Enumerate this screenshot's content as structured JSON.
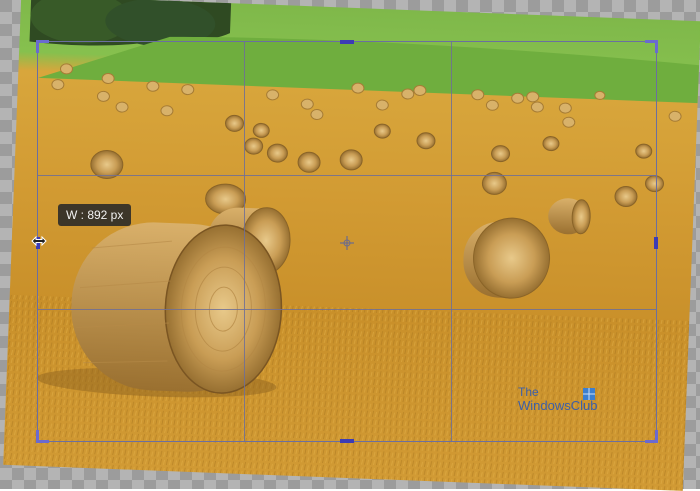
{
  "tooltip": {
    "label": "W : 892 px"
  },
  "watermark": {
    "line1": "The",
    "line2": "WindowsClub"
  },
  "colors": {
    "crop_handle": "#3c3cb4",
    "grid_line": "#6e6e96",
    "tooltip_bg": "#282828"
  }
}
